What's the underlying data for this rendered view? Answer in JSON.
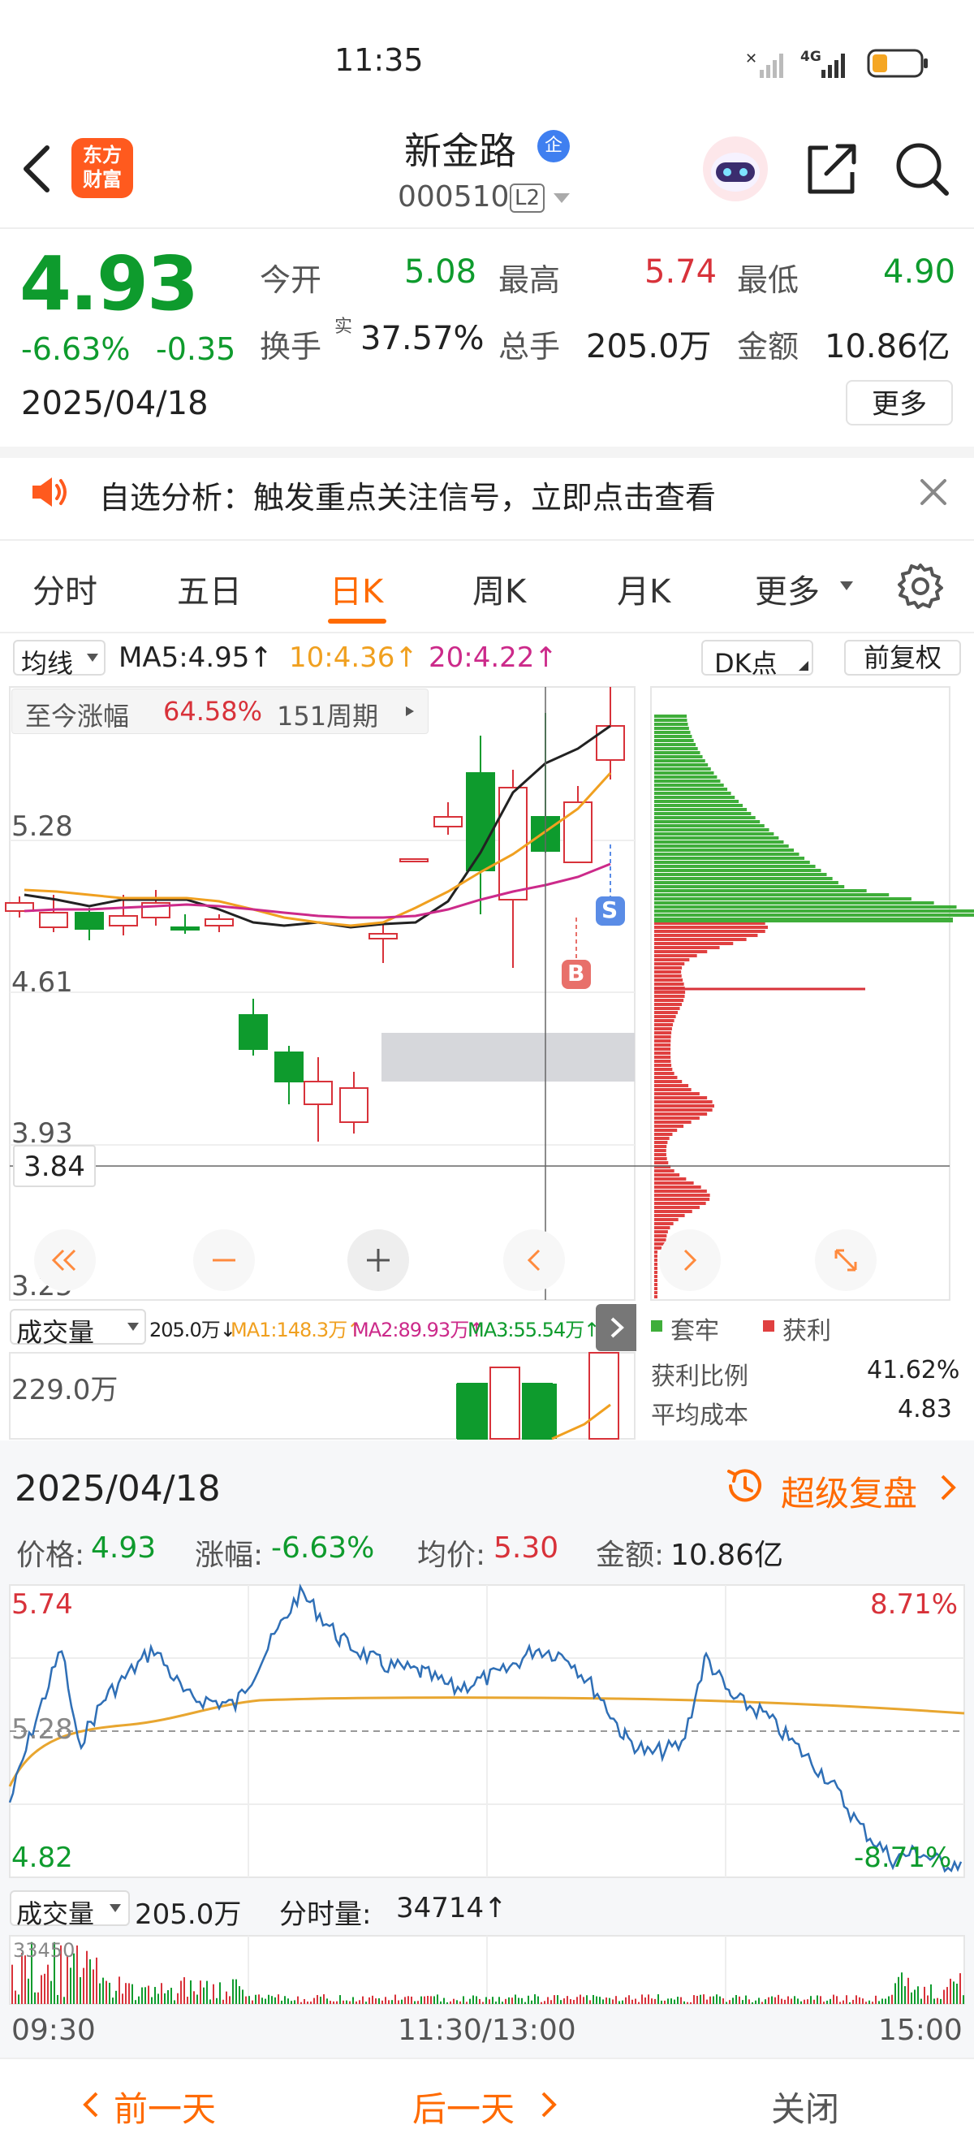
{
  "status_bar": {
    "time": "11:35",
    "network": "4G"
  },
  "header": {
    "stock_name": "新金路",
    "badge": "企",
    "code": "000510",
    "level": "L2",
    "logo_line1": "东方",
    "logo_line2": "财富"
  },
  "quote": {
    "price": "4.93",
    "change_pct": "-6.63%",
    "change": "-0.35",
    "date": "2025/04/18",
    "open_label": "今开",
    "open": "5.08",
    "high_label": "最高",
    "high": "5.74",
    "low_label": "最低",
    "low": "4.90",
    "turnover_label": "换手",
    "turnover_sup": "实",
    "turnover": "37.57%",
    "volume_label": "总手",
    "volume": "205.0万",
    "amount_label": "金额",
    "amount": "10.86亿",
    "more_label": "更多"
  },
  "notice": {
    "text": "自选分析：触发重点关注信号，立即点击查看"
  },
  "tabs": [
    {
      "label": "分时",
      "active": false
    },
    {
      "label": "五日",
      "active": false
    },
    {
      "label": "日K",
      "active": true
    },
    {
      "label": "周K",
      "active": false
    },
    {
      "label": "月K",
      "active": false
    },
    {
      "label": "更多",
      "active": false
    }
  ],
  "kline": {
    "indicator_label": "均线",
    "ma5": "MA5:4.95↑",
    "ma10": "10:4.36↑",
    "ma20": "20:4.22↑",
    "dk_label": "DK点",
    "adjust_label": "前复权",
    "since_label": "至今涨幅",
    "since_value": "64.58%",
    "since_period": "151周期",
    "y_labels": [
      "5.28",
      "4.61",
      "3.93",
      "3.25"
    ],
    "crosshair_value": "3.84",
    "sell_tag": "S",
    "buy_tag": "B",
    "colors": {
      "up": "#d8323a",
      "down": "#0e9b2d",
      "ma5": "#222222",
      "ma10": "#f0a020",
      "ma20": "#cc2a8a"
    }
  },
  "volume_panel": {
    "label": "成交量",
    "value": "205.0万↓",
    "ma1": "MA1:148.3万↑",
    "ma2": "MA2:89.93万↑",
    "ma3": "MA3:55.54万↑",
    "max_label": "229.0万"
  },
  "chip": {
    "legend_locked": "套牢",
    "legend_profit": "获利",
    "profit_ratio_label": "获利比例",
    "profit_ratio": "41.62%",
    "avg_cost_label": "平均成本",
    "avg_cost": "4.83"
  },
  "intraday": {
    "date": "2025/04/18",
    "replay_label": "超级复盘",
    "price_label": "价格:",
    "price": "4.93",
    "change_label": "涨幅:",
    "change": "-6.63%",
    "avg_label": "均价:",
    "avg": "5.30",
    "amount_label": "金额:",
    "amount": "10.86亿",
    "y_top": "5.74",
    "y_mid": "5.28",
    "y_bot": "4.82",
    "pct_top": "8.71%",
    "pct_bot": "-8.71%",
    "volume_label": "成交量",
    "volume": "205.0万",
    "tick_label": "分时量:",
    "tick_volume": "34714↑",
    "vol_max": "33450",
    "time_start": "09:30",
    "time_mid": "11:30/13:00",
    "time_end": "15:00"
  },
  "bottom_bar": {
    "prev": "前一天",
    "next": "后一天",
    "close": "关闭"
  }
}
